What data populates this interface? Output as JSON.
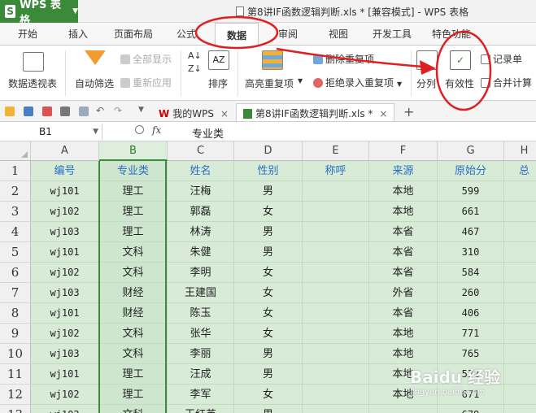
{
  "app": {
    "name": "WPS 表格",
    "window_title": "第8讲IF函数逻辑判断.xls * [兼容模式] - WPS 表格"
  },
  "tabs": [
    "开始",
    "插入",
    "页面布局",
    "公式",
    "数据",
    "审阅",
    "视图",
    "开发工具",
    "特色功能"
  ],
  "active_tab": "数据",
  "ribbon": {
    "pivot": "数据透视表",
    "autofilter": "自动筛选",
    "show_all": "全部显示",
    "reapply": "重新应用",
    "sort": "排序",
    "highlight_dup": "高亮重复项",
    "delete_dup": "删除重复项",
    "reject_dup": "拒绝录入重复项",
    "split": "分列",
    "validity": "有效性",
    "record": "记录单",
    "consolidate": "合并计算"
  },
  "doc_tabs": {
    "home": "我的WPS",
    "file": "第8讲IF函数逻辑判断.xls *"
  },
  "formula_bar": {
    "name_box": "B1",
    "fx": "fx",
    "value": "专业类"
  },
  "columns": [
    "A",
    "B",
    "C",
    "D",
    "E",
    "F",
    "G",
    "H"
  ],
  "selected_column": "B",
  "rows": [
    "1",
    "2",
    "3",
    "4",
    "5",
    "6",
    "7",
    "8",
    "9",
    "10",
    "11",
    "12",
    "13"
  ],
  "headers": [
    "编号",
    "专业类",
    "姓名",
    "性别",
    "称呼",
    "来源",
    "原始分",
    "总"
  ],
  "data": [
    [
      "wj101",
      "理工",
      "汪梅",
      "男",
      "",
      "本地",
      "599"
    ],
    [
      "wj102",
      "理工",
      "郭磊",
      "女",
      "",
      "本地",
      "661"
    ],
    [
      "wj103",
      "理工",
      "林涛",
      "男",
      "",
      "本省",
      "467"
    ],
    [
      "wj101",
      "文科",
      "朱健",
      "男",
      "",
      "本省",
      "310"
    ],
    [
      "wj102",
      "文科",
      "李明",
      "女",
      "",
      "本省",
      "584"
    ],
    [
      "wj103",
      "财经",
      "王建国",
      "女",
      "",
      "外省",
      "260"
    ],
    [
      "wj101",
      "财经",
      "陈玉",
      "女",
      "",
      "本省",
      "406"
    ],
    [
      "wj102",
      "文科",
      "张华",
      "女",
      "",
      "本地",
      "771"
    ],
    [
      "wj103",
      "文科",
      "李丽",
      "男",
      "",
      "本地",
      "765"
    ],
    [
      "wj101",
      "理工",
      "汪成",
      "男",
      "",
      "本地",
      "532"
    ],
    [
      "wj102",
      "理工",
      "李军",
      "女",
      "",
      "本地",
      "671"
    ],
    [
      "wj103",
      "文科",
      "王红英",
      "男",
      "",
      "",
      "679"
    ]
  ],
  "watermark": {
    "title": "Baidu 经验",
    "sub": "jingyan.baidu.com"
  },
  "colors": {
    "accent": "#3a8a3a",
    "annotation": "#e02020",
    "header_text": "#2a6ec2",
    "grid_bg": "#d7ebd7"
  }
}
